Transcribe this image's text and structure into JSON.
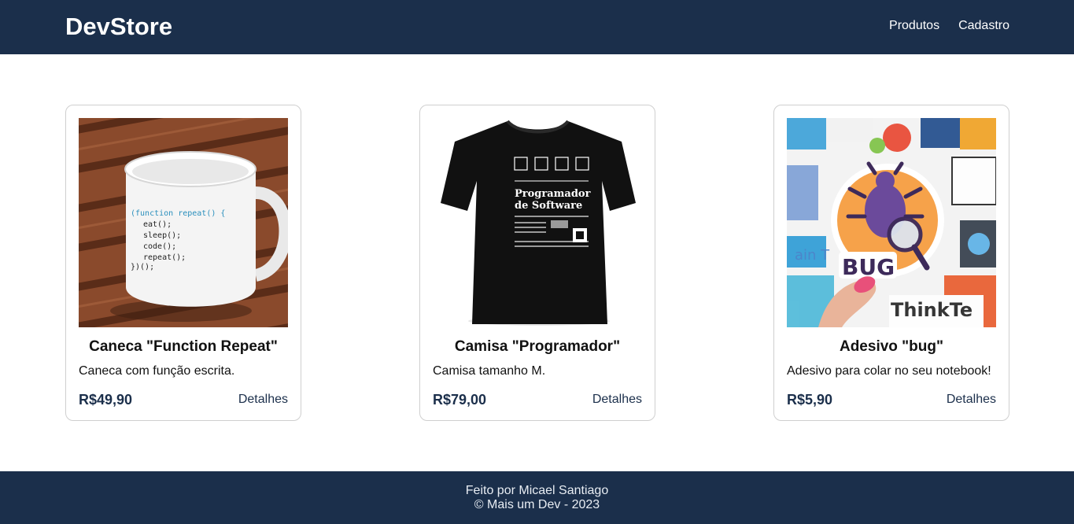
{
  "header": {
    "brand": "DevStore",
    "nav": [
      "Produtos",
      "Cadastro"
    ]
  },
  "products": [
    {
      "title": "Caneca \"Function Repeat\"",
      "description": "Caneca com função escrita.",
      "price": "R$49,90",
      "details_label": "Detalhes",
      "image_icon": "mug-image",
      "mug_code": [
        "(function repeat() {",
        "eat();",
        "sleep();",
        "code();",
        "repeat();",
        "})();"
      ]
    },
    {
      "title": "Camisa \"Programador\"",
      "description": "Camisa tamanho M.",
      "price": "R$79,00",
      "details_label": "Detalhes",
      "image_icon": "tshirt-image",
      "shirt_print": [
        "Programador",
        "de Software"
      ]
    },
    {
      "title": "Adesivo \"bug\"",
      "description": "Adesivo para colar no seu notebook!",
      "price": "R$5,90",
      "details_label": "Detalhes",
      "image_icon": "sticker-image",
      "sticker_text": "BUG"
    }
  ],
  "footer": {
    "line1": "Feito por Micael Santiago",
    "line2": "© Mais um Dev - 2023"
  },
  "colors": {
    "header_bg": "#1b2f4b",
    "price": "#1b2f4b",
    "card_border": "#cfcfcf"
  }
}
